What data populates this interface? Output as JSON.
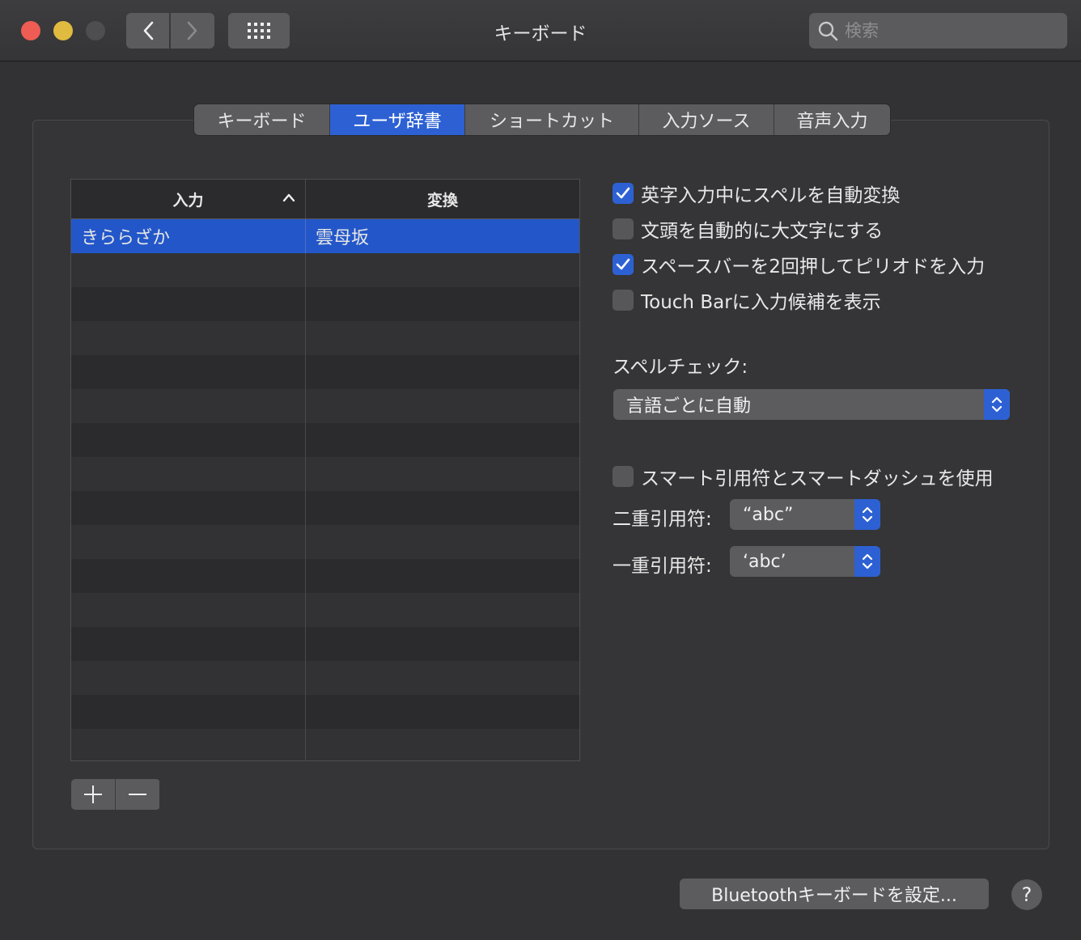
{
  "window": {
    "title": "キーボード"
  },
  "search": {
    "placeholder": "検索"
  },
  "tabs": [
    {
      "label": "キーボード",
      "active": false
    },
    {
      "label": "ユーザ辞書",
      "active": true
    },
    {
      "label": "ショートカット",
      "active": false
    },
    {
      "label": "入力ソース",
      "active": false
    },
    {
      "label": "音声入力",
      "active": false
    }
  ],
  "table": {
    "columns": [
      "入力",
      "変換"
    ],
    "rows": [
      {
        "input": "きららざか",
        "conversion": "雲母坂",
        "selected": true
      }
    ]
  },
  "options": {
    "autocorrect": {
      "label": "英字入力中にスペルを自動変換",
      "checked": true
    },
    "autocapitalize": {
      "label": "文頭を自動的に大文字にする",
      "checked": false
    },
    "period": {
      "label": "スペースバーを2回押してピリオドを入力",
      "checked": true
    },
    "touchbar": {
      "label": "Touch Barに入力候補を表示",
      "checked": false
    },
    "spellcheck_label": "スペルチェック:",
    "spellcheck_value": "言語ごとに自動",
    "smartquotes": {
      "label": "スマート引用符とスマートダッシュを使用",
      "checked": false
    },
    "double_quote_label": "二重引用符:",
    "double_quote_value": "“abc”",
    "single_quote_label": "一重引用符:",
    "single_quote_value": "‘abc’"
  },
  "footer": {
    "bluetooth_button": "Bluetoothキーボードを設定...",
    "help": "?"
  },
  "colors": {
    "accent": "#2d61d3",
    "selection": "#2357c9"
  }
}
